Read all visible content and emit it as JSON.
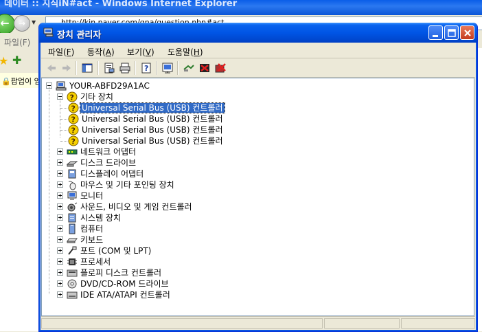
{
  "background_window": {
    "title": "데이터 :: 지식iN#act - Windows Internet Explorer",
    "address": "http://kin.naver.com/qna/question.nhn#act",
    "menu_file": "파일(F)",
    "popup_text": "팝업이 임"
  },
  "window": {
    "title": "장치 관리자"
  },
  "menu": [
    {
      "label": "파일(",
      "acc": "F",
      "tail": ")"
    },
    {
      "label": "동작(",
      "acc": "A",
      "tail": ")"
    },
    {
      "label": "보기(",
      "acc": "V",
      "tail": ")"
    },
    {
      "label": "도움말(",
      "acc": "H",
      "tail": ")"
    }
  ],
  "toolbar": {
    "icons": [
      "back-arrow-icon",
      "forward-arrow-icon",
      "show-hide-tree-icon",
      "properties-icon",
      "print-icon",
      "help-icon",
      "scan-hardware-icon",
      "update-driver-icon",
      "disable-device-icon",
      "uninstall-device-icon"
    ]
  },
  "tree": {
    "root": "YOUR-ABFD29A1AC",
    "other_devices": {
      "label": "기타 장치",
      "children": [
        "Universal Serial Bus (USB) 컨트롤러",
        "Universal Serial Bus (USB) 컨트롤러",
        "Universal Serial Bus (USB) 컨트롤러",
        "Universal Serial Bus (USB) 컨트롤러"
      ]
    },
    "categories": [
      "네트워크 어댑터",
      "디스크 드라이브",
      "디스플레이 어댑터",
      "마우스 및 기타 포인팅 장치",
      "모니터",
      "사운드, 비디오 및 게임 컨트롤러",
      "시스템 장치",
      "컴퓨터",
      "키보드",
      "포트 (COM 및 LPT)",
      "프로세서",
      "플로피 디스크 컨트롤러",
      "DVD/CD-ROM 드라이브",
      "IDE ATA/ATAPI 컨트롤러"
    ]
  },
  "colors": {
    "selection": "#316ac5",
    "title_blue": "#0055e5",
    "warning_yellow": "#f5d000"
  }
}
